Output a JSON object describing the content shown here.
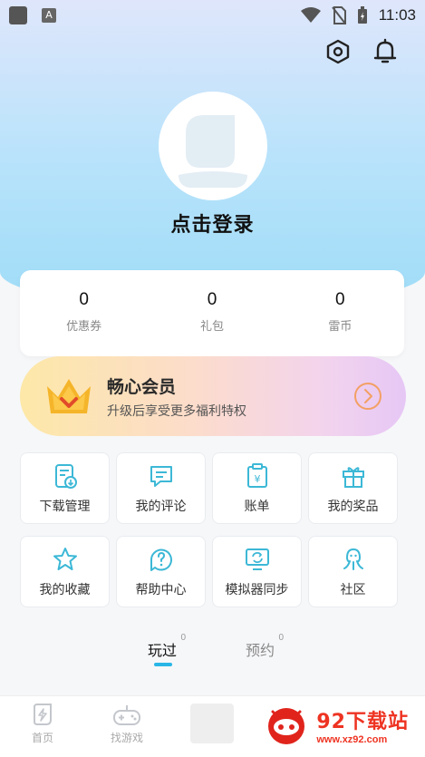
{
  "status_bar": {
    "time": "11:03",
    "a_label": "A"
  },
  "profile": {
    "login_label": "点击登录"
  },
  "stats": [
    {
      "value": "0",
      "label": "优惠券"
    },
    {
      "value": "0",
      "label": "礼包"
    },
    {
      "value": "0",
      "label": "雷币"
    }
  ],
  "vip": {
    "title": "畅心会员",
    "subtitle": "升级后享受更多福利特权"
  },
  "grid": [
    {
      "label": "下载管理",
      "icon": "download-manage-icon"
    },
    {
      "label": "我的评论",
      "icon": "comment-icon"
    },
    {
      "label": "账单",
      "icon": "bill-icon"
    },
    {
      "label": "我的奖品",
      "icon": "gift-icon"
    },
    {
      "label": "我的收藏",
      "icon": "star-icon"
    },
    {
      "label": "帮助中心",
      "icon": "help-icon"
    },
    {
      "label": "模拟器同步",
      "icon": "sync-icon"
    },
    {
      "label": "社区",
      "icon": "community-icon"
    }
  ],
  "tabs": [
    {
      "label": "玩过",
      "count": "0"
    },
    {
      "label": "预约",
      "count": "0"
    }
  ],
  "bottom_nav": [
    {
      "label": "首页"
    },
    {
      "label": "找游戏"
    }
  ],
  "watermark": {
    "title": "92下载站",
    "url": "www.xz92.com"
  },
  "colors": {
    "accent": "#29b6e6",
    "icon_color": "#3cb8d6"
  }
}
